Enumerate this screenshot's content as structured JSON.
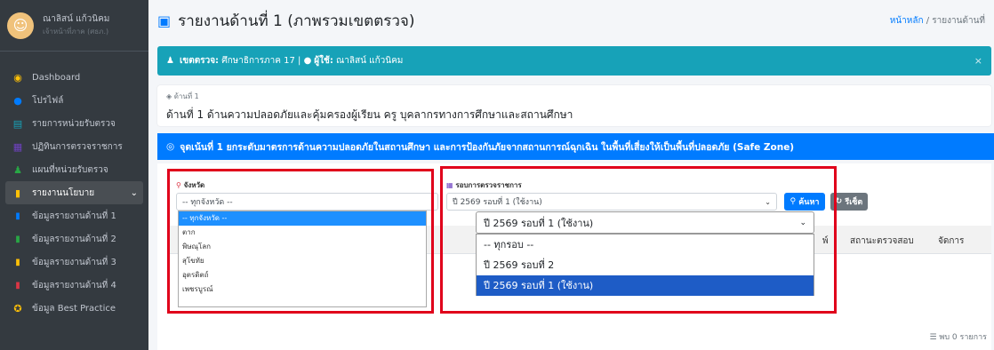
{
  "user": {
    "name": "ณาลิสน์ แก้วนิคม",
    "role": "เจ้าหน้าที่ภาค (ศธภ.)"
  },
  "sidebar": {
    "items": [
      {
        "label": "Dashboard",
        "icon": "dashboard-icon",
        "color": "#ffc107"
      },
      {
        "label": "โปรไฟล์",
        "icon": "user-icon",
        "color": "#007bff"
      },
      {
        "label": "รายการหน่วยรับตรวจ",
        "icon": "list-icon",
        "color": "#17a2b8"
      },
      {
        "label": "ปฏิทินการตรวจราชการ",
        "icon": "calendar-icon",
        "color": "#6f42c1"
      },
      {
        "label": "แผนที่หน่วยรับตรวจ",
        "icon": "users-icon",
        "color": "#28a745"
      },
      {
        "label": "รายงานนโยบาย",
        "icon": "book-icon",
        "color": "#ffc107",
        "active": true
      },
      {
        "label": "ข้อมูลรายงานด้านที่ 1",
        "icon": "file-icon",
        "color": "#007bff"
      },
      {
        "label": "ข้อมูลรายงานด้านที่ 2",
        "icon": "file-icon",
        "color": "#28a745"
      },
      {
        "label": "ข้อมูลรายงานด้านที่ 3",
        "icon": "file-icon",
        "color": "#ffc107"
      },
      {
        "label": "ข้อมูลรายงานด้านที่ 4",
        "icon": "file-icon",
        "color": "#dc3545"
      },
      {
        "label": "ข้อมูล Best Practice",
        "icon": "award-icon",
        "color": "#ffc107"
      }
    ]
  },
  "header": {
    "title": "รายงานด้านที่ 1 (ภาพรวมเขตตรวจ)",
    "breadcrumb_home": "หน้าหลัก",
    "breadcrumb_sep": "/",
    "breadcrumb_current": "รายงานด้านที่"
  },
  "infobar": {
    "zone_label": "เขตตรวจ:",
    "zone_value": "ศึกษาธิการภาค 17",
    "separator": "|",
    "user_label": "ผู้ใช้:",
    "user_value": "ณาลิสน์ แก้วนิคม",
    "color": "#17a2b8"
  },
  "aspect": {
    "small_label": "ด้านที่ 1",
    "title": "ด้านที่ 1 ด้านความปลอดภัยและคุ้มครองผู้เรียน ครู บุคลากรทางการศึกษาและสถานศึกษา"
  },
  "focus": {
    "text": "จุดเน้นที่ 1 ยกระดับมาตรการด้านความปลอดภัยในสถานศึกษา และการป้องกันภัยจากสถานการณ์ฉุกเฉิน ในพื้นที่เสี่ยงให้เป็นพื้นที่ปลอดภัย (Safe Zone)",
    "color": "#007bff"
  },
  "filters": {
    "province_label": "จังหวัด",
    "province_value": "-- ทุกจังหวัด --",
    "province_options": [
      "-- ทุกจังหวัด --",
      "ตาก",
      "พิษณุโลก",
      "สุโขทัย",
      "อุตรดิตถ์",
      "เพชรบูรณ์"
    ],
    "round_label": "รอบการตรวจราชการ",
    "round_value": "ปี 2569 รอบที่ 1 (ใช้งาน)",
    "round_options": [
      "-- ทุกรอบ --",
      "ปี 2569 รอบที่ 2",
      "ปี 2569 รอบที่ 1 (ใช้งาน)"
    ],
    "search_label": "ค้นหา",
    "reset_label": "รีเซ็ต"
  },
  "table": {
    "col_status": "สถานะตรวจสอบ",
    "col_manage": "จัดการ",
    "partial": "พ์"
  },
  "footer": {
    "count_text": "พบ 0 รายการ"
  }
}
